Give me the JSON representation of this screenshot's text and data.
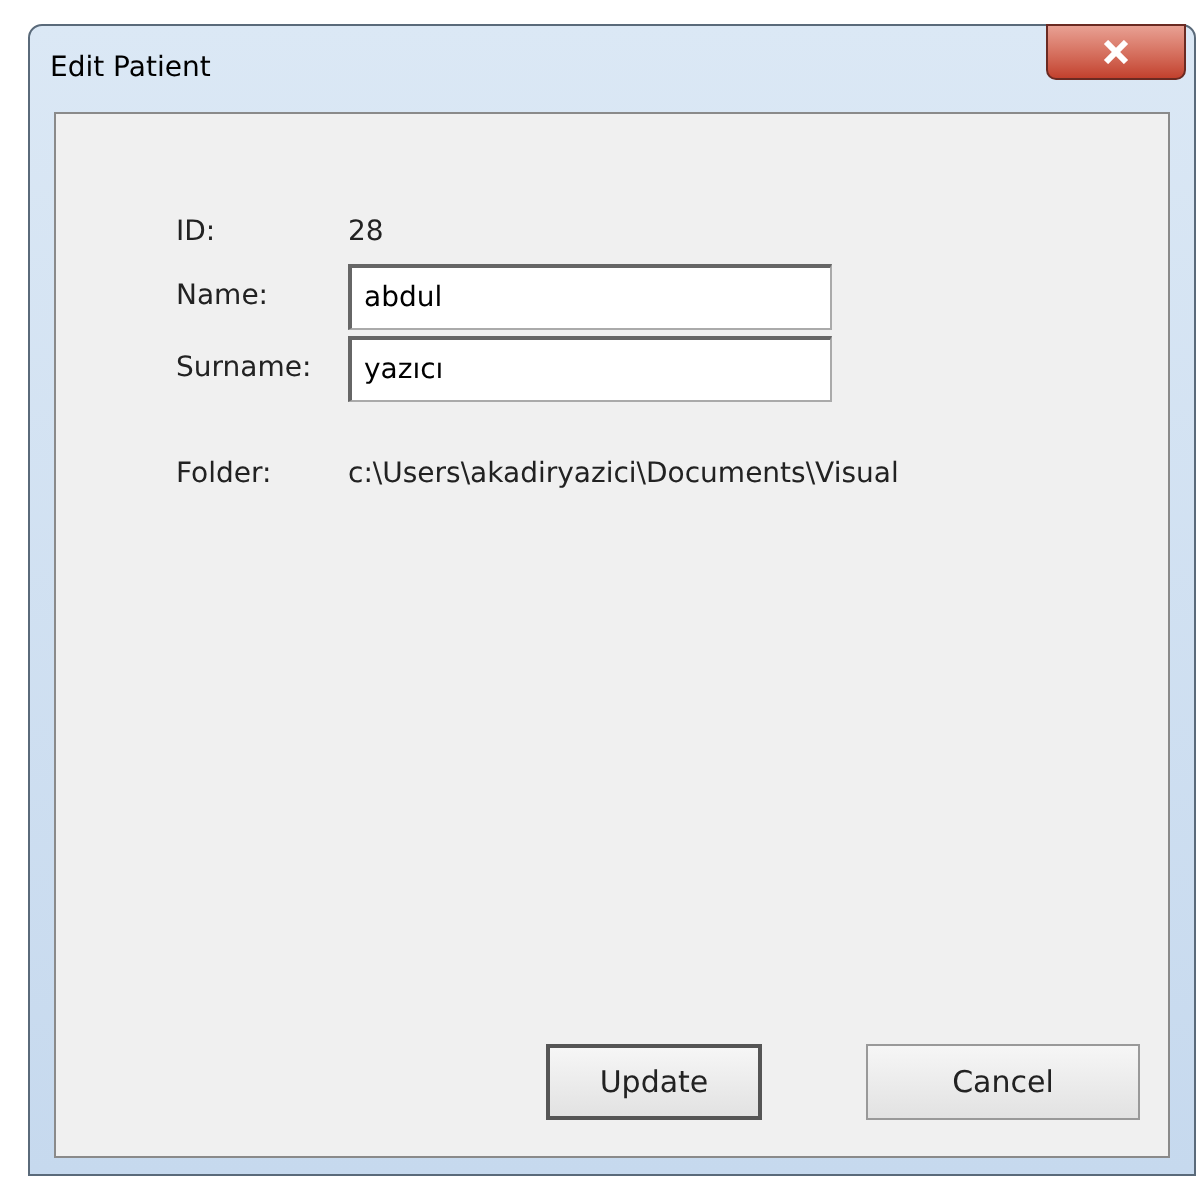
{
  "window": {
    "title": "Edit Patient"
  },
  "fields": [
    {
      "label": "ID:",
      "kind": "text",
      "value": "28"
    },
    {
      "label": "Name:",
      "kind": "input",
      "value": "abdul"
    },
    {
      "label": "Surname:",
      "kind": "input",
      "value": "yazıcı"
    },
    {
      "label": "Folder:",
      "kind": "text",
      "value": "c:\\Users\\akadiryazici\\Documents\\Visual"
    }
  ],
  "buttons": [
    {
      "label": "Update",
      "default": true
    },
    {
      "label": "Cancel",
      "default": false
    }
  ]
}
